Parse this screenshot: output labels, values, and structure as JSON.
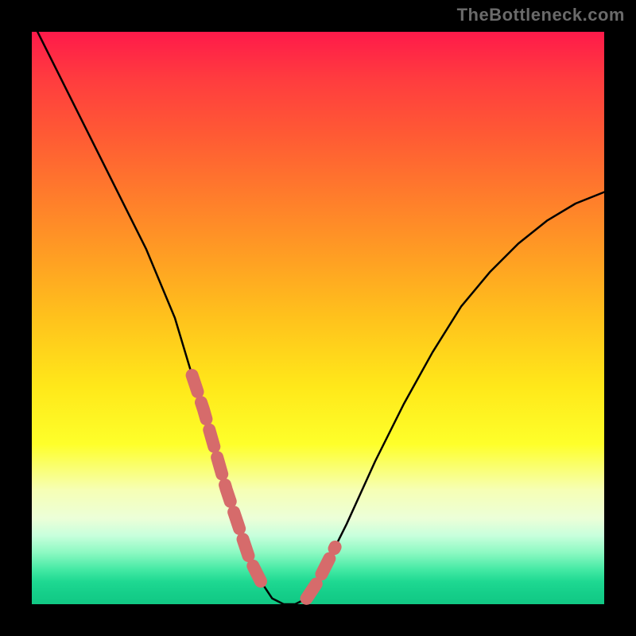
{
  "watermark": "TheBottleneck.com",
  "chart_data": {
    "type": "line",
    "title": "",
    "xlabel": "",
    "ylabel": "",
    "xlim": [
      0,
      100
    ],
    "ylim": [
      0,
      100
    ],
    "series": [
      {
        "name": "bottleneck-curve",
        "x": [
          0,
          5,
          10,
          15,
          20,
          25,
          28,
          30,
          32,
          34,
          36,
          38,
          40,
          42,
          44,
          46,
          48,
          50,
          55,
          60,
          65,
          70,
          75,
          80,
          85,
          90,
          95,
          100
        ],
        "values": [
          102,
          92,
          82,
          72,
          62,
          50,
          40,
          34,
          27,
          20,
          14,
          8,
          4,
          1,
          0,
          0,
          1,
          4,
          14,
          25,
          35,
          44,
          52,
          58,
          63,
          67,
          70,
          72
        ]
      }
    ],
    "highlight_segments": [
      {
        "name": "left-descent-highlight",
        "x_start": 28,
        "x_end": 40
      },
      {
        "name": "right-ascent-highlight",
        "x_start": 48,
        "x_end": 53
      }
    ],
    "colors": {
      "curve_stroke": "#000000",
      "highlight_stroke": "#d66b6b",
      "gradient_top": "#ff1a4a",
      "gradient_bottom": "#11c884",
      "frame": "#000000"
    }
  }
}
